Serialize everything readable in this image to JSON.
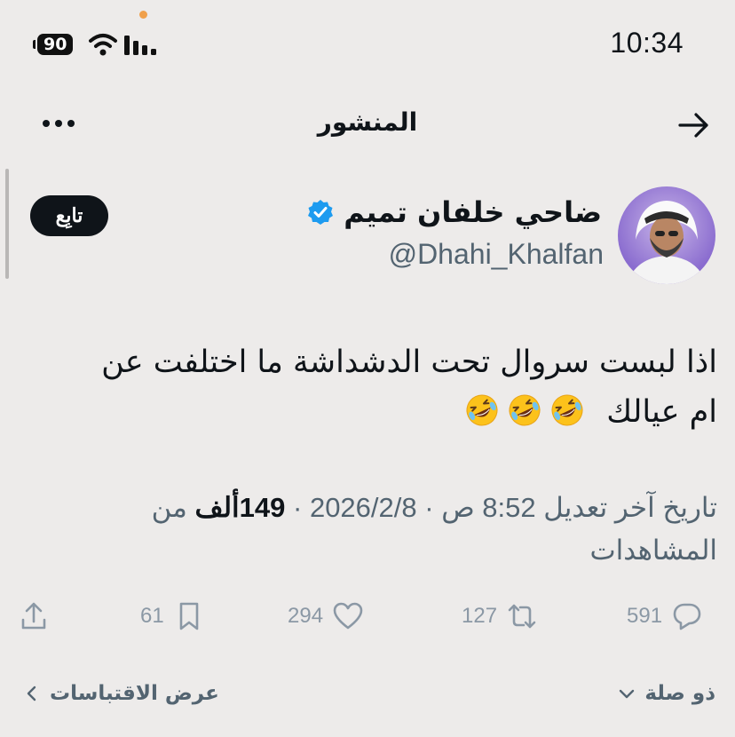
{
  "status_bar": {
    "battery": "90",
    "time": "10:34"
  },
  "header": {
    "title": "المنشور",
    "more_icon": "more-horizontal-icon",
    "back_icon": "arrow-right-icon"
  },
  "profile": {
    "name": "ضاحي خلفان تميم",
    "handle": "@Dhahi_Khalfan",
    "verified": true,
    "follow_label": "تابِع"
  },
  "tweet": {
    "line1": "اذا لبست سروال  تحت الدشداشة ما اختلفت عن",
    "line2": "ام عيالك",
    "emoji": "rolling-on-floor-laughing",
    "emoji_count": 3
  },
  "meta": {
    "edited": "تاريخ آخر تعديل",
    "time": "8:52 ص",
    "date": "2026/2/8",
    "views_value": "149ألف",
    "views_label": "من المشاهدات"
  },
  "actions": {
    "replies": "591",
    "reposts": "127",
    "likes": "294",
    "bookmarks": "61"
  },
  "footer": {
    "relevant": "ذو صلة",
    "view_quotes": "عرض الاقتباسات"
  },
  "colors": {
    "background": "#edebea",
    "verified": "#1d9bf0",
    "muted": "#536471"
  }
}
